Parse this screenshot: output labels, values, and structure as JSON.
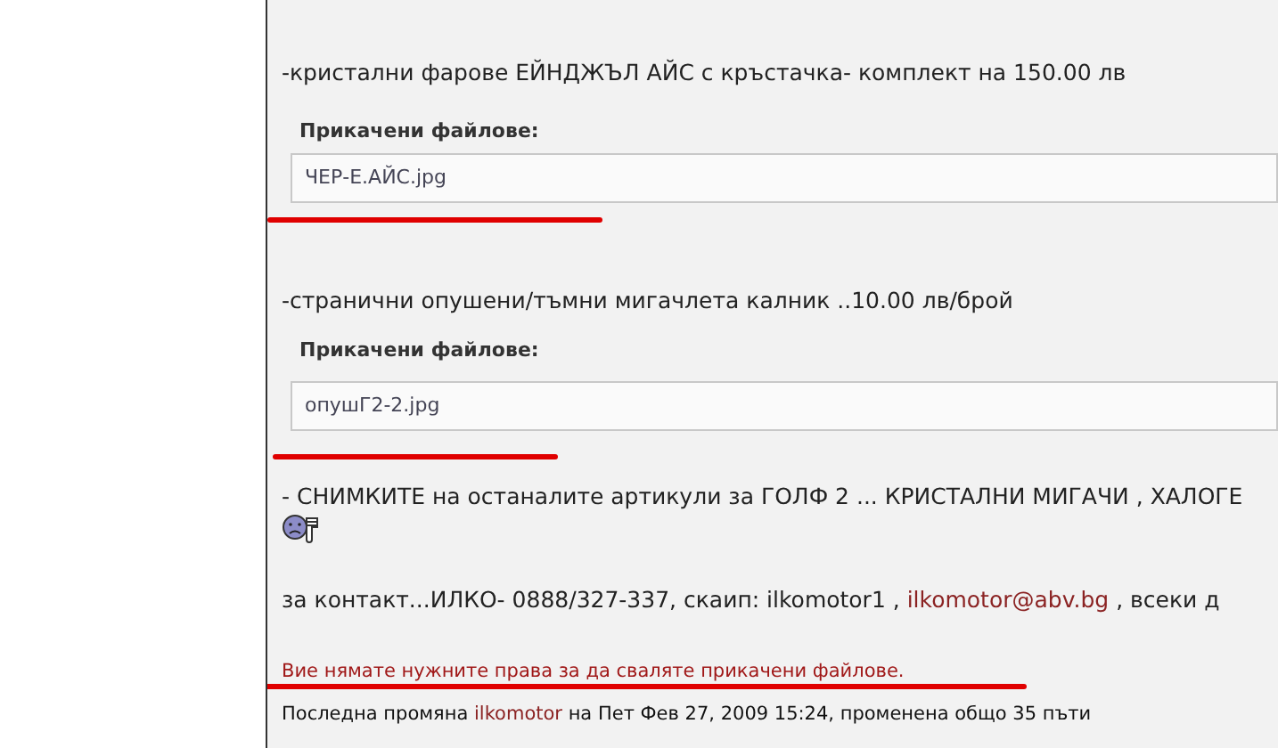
{
  "post": {
    "items": [
      {
        "kind": "text",
        "segments": [
          {
            "text": "-кристални фарове ЕЙНДЖЪЛ АЙС с кръстачка- комплект на 150.00 лв"
          }
        ]
      },
      {
        "kind": "attachment",
        "label": "Прикачени файлове:",
        "file": "ЧЕР-Е.АЙС.jpg"
      },
      {
        "kind": "text",
        "segments": [
          {
            "text": "-странични опушени/тъмни мигачлета калник ..10.00 лв/брой"
          }
        ]
      },
      {
        "kind": "attachment",
        "label": "Прикачени файлове:",
        "file": "опушГ2-2.jpg"
      },
      {
        "kind": "text",
        "segments": [
          {
            "text": "- СНИМКИТЕ на останалите артикули за ГОЛФ 2 ... КРИСТАЛНИ МИГАЧИ , ХАЛОГЕ"
          }
        ]
      },
      {
        "kind": "smiley"
      },
      {
        "kind": "text",
        "segments": [
          {
            "text": "за контакт...ИЛКО- 0888/327-337, скаип: ilkomotor1 , "
          },
          {
            "link": "ilkomotor@abv.bg"
          },
          {
            "text": " , всеки д"
          }
        ]
      },
      {
        "kind": "notice",
        "segments": [
          {
            "text": "Вие нямате нужните права за да сваляте прикачени файлове."
          }
        ]
      },
      {
        "kind": "edit_note",
        "segments": [
          {
            "text": "Последна промяна "
          },
          {
            "link": "ilkomotor"
          },
          {
            "text": " на Пет Фев 27, 2009 15:24, променена общо 35 пъти"
          }
        ]
      }
    ]
  }
}
